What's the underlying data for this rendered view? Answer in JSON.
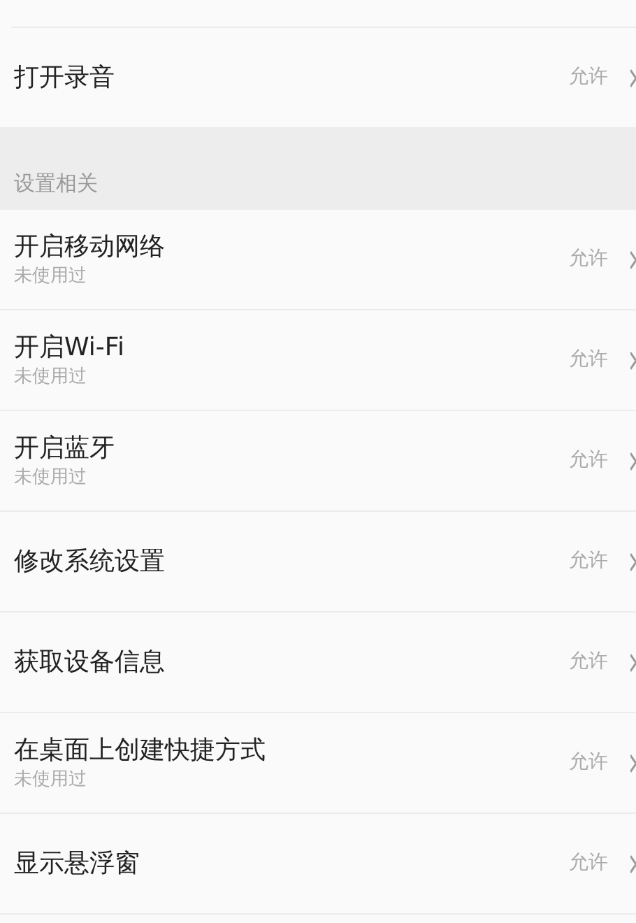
{
  "top_rows": [
    {
      "title": "打开录音",
      "value": "允许"
    }
  ],
  "section": {
    "header": "设置相关",
    "rows": [
      {
        "title": "开启移动网络",
        "subtitle": "未使用过",
        "value": "允许"
      },
      {
        "title": "开启Wi-Fi",
        "subtitle": "未使用过",
        "value": "允许"
      },
      {
        "title": "开启蓝牙",
        "subtitle": "未使用过",
        "value": "允许"
      },
      {
        "title": "修改系统设置",
        "value": "允许"
      },
      {
        "title": "获取设备信息",
        "value": "允许"
      },
      {
        "title": "在桌面上创建快捷方式",
        "subtitle": "未使用过",
        "value": "允许"
      },
      {
        "title": "显示悬浮窗",
        "value": "允许"
      }
    ]
  }
}
